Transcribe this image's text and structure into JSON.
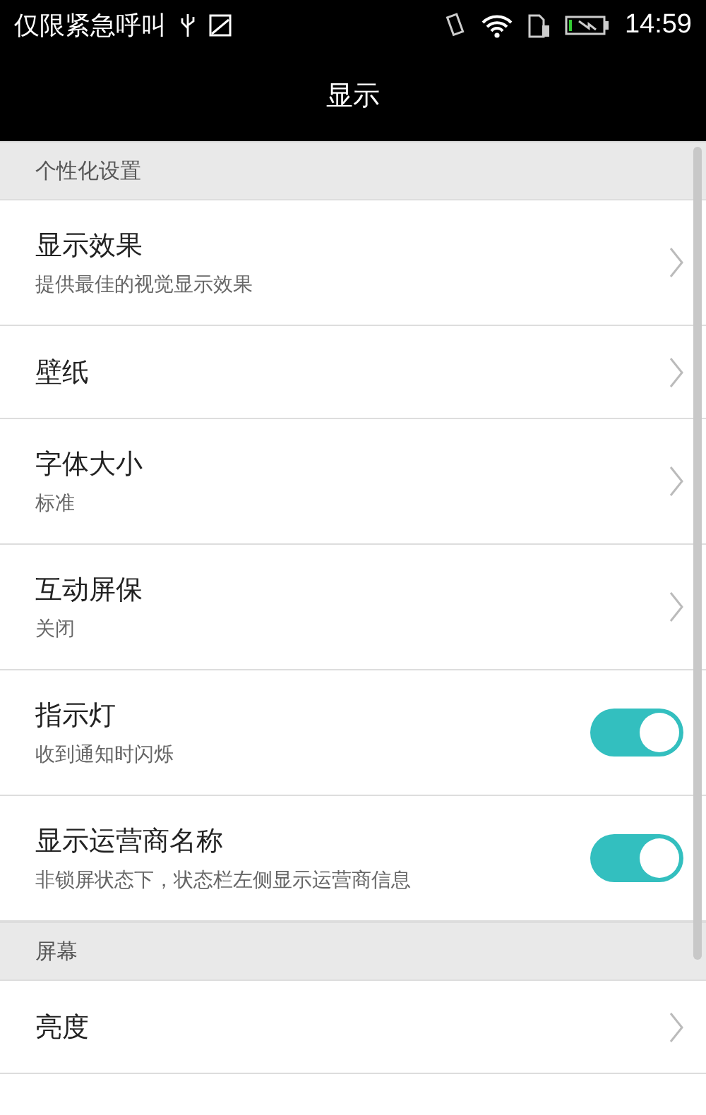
{
  "status_bar": {
    "carrier": "仅限紧急呼叫",
    "time": "14:59"
  },
  "window": {
    "title": "显示"
  },
  "sections": [
    {
      "header": "个性化设置",
      "items": [
        {
          "kind": "link",
          "title": "显示效果",
          "subtitle": "提供最佳的视觉显示效果"
        },
        {
          "kind": "link",
          "title": "壁纸"
        },
        {
          "kind": "link",
          "title": "字体大小",
          "subtitle": "标准"
        },
        {
          "kind": "link",
          "title": "互动屏保",
          "subtitle": "关闭"
        },
        {
          "kind": "toggle",
          "title": "指示灯",
          "subtitle": "收到通知时闪烁",
          "on": true
        },
        {
          "kind": "toggle",
          "title": "显示运营商名称",
          "subtitle": "非锁屏状态下，状态栏左侧显示运营商信息",
          "on": true
        }
      ]
    },
    {
      "header": "屏幕",
      "items": [
        {
          "kind": "link",
          "title": "亮度"
        }
      ]
    }
  ]
}
